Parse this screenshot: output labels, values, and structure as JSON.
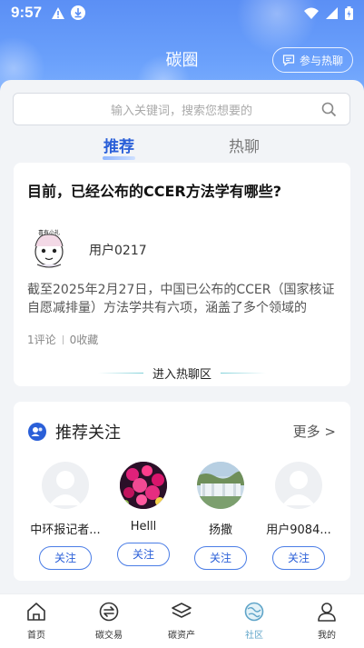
{
  "status_bar": {
    "time": "9:57"
  },
  "header": {
    "title": "碳圈",
    "join_label": "参与热聊"
  },
  "search": {
    "placeholder": "输入关键词，搜索您想要的"
  },
  "tabs": [
    {
      "label": "推荐",
      "active": true
    },
    {
      "label": "热聊",
      "active": false
    }
  ],
  "post": {
    "question": "目前，已经公布的CCER方法学有哪些?",
    "avatar_text": "喜有小礼",
    "user": "用户0217",
    "excerpt": "截至2025年2月27日，中国已公布的CCER（国家核证自愿减排量）方法学共有六项，涵盖了多个领域的",
    "comments": "1评论",
    "favorites": "0收藏",
    "enter_label": "进入热聊区"
  },
  "recommend": {
    "title": "推荐关注",
    "more": "更多 >",
    "users": [
      {
        "name": "中环报记者...",
        "follow": "关注",
        "avatar": "default"
      },
      {
        "name": "Helll",
        "follow": "关注",
        "avatar": "flowers"
      },
      {
        "name": "扬撒",
        "follow": "关注",
        "avatar": "waterfall"
      },
      {
        "name": "用户9084...",
        "follow": "关注",
        "avatar": "default"
      }
    ]
  },
  "tabbar": [
    {
      "label": "首页",
      "icon": "home-icon",
      "active": false
    },
    {
      "label": "碳交易",
      "icon": "exchange-icon",
      "active": false
    },
    {
      "label": "碳资产",
      "icon": "layers-icon",
      "active": false
    },
    {
      "label": "社区",
      "icon": "community-icon",
      "active": true
    },
    {
      "label": "我的",
      "icon": "person-icon",
      "active": false
    }
  ],
  "colors": {
    "accent": "#2a5fd8",
    "header": "#6aa0fb",
    "tab_active": "#5fa4c8"
  }
}
